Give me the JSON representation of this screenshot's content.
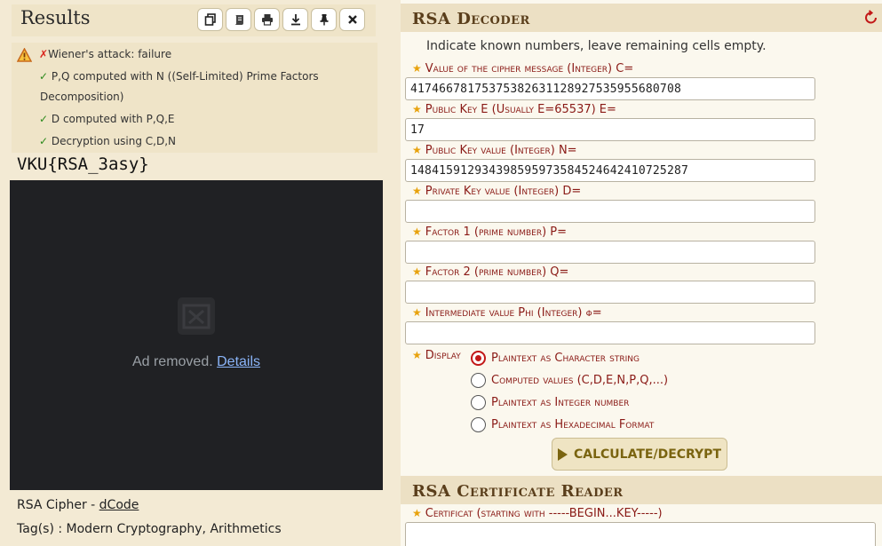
{
  "results": {
    "title": "Results",
    "toolbar": {
      "copy_icon": "copy-icon",
      "script_icon": "scroll-icon",
      "print_icon": "print-icon",
      "download_icon": "download-icon",
      "pin_icon": "pin-icon",
      "close_icon": "close-icon"
    },
    "log": {
      "attack_failed": "Wiener's attack: failure",
      "line_pq": "P,Q computed with N ((Self-Limited) Prime Factors",
      "line_pq_cont": "Decomposition)",
      "line_d": "D computed with P,Q,E",
      "line_decrypt": "Decryption using C,D,N"
    },
    "flag": "VKU{RSA_3asy}",
    "ad": {
      "text": "Ad removed.",
      "link": "Details"
    },
    "footer": {
      "cipher_name": "RSA Cipher - ",
      "cipher_link": "dCode",
      "tags": "Tag(s) : Modern Cryptography, Arithmetics"
    }
  },
  "decoder": {
    "title": "RSA Decoder",
    "instructions": "Indicate known numbers, leave remaining cells empty.",
    "fields": [
      {
        "label": "Value of the cipher message (Integer) C=",
        "value": "41746678175375382631128927535955680708"
      },
      {
        "label": "Public Key E (Usually E=65537) E=",
        "value": "17"
      },
      {
        "label": "Public Key value (Integer) N=",
        "value": "148415912934398595973584524642410725287"
      },
      {
        "label": "Private Key value (Integer) D=",
        "value": ""
      },
      {
        "label": "Factor 1 (prime number) P=",
        "value": ""
      },
      {
        "label": "Factor 2 (prime number) Q=",
        "value": ""
      },
      {
        "label": "Intermediate value Phi (Integer) φ=",
        "value": ""
      }
    ],
    "display_label": "Display",
    "display_options": [
      {
        "label": "Plaintext as Character string",
        "checked": true
      },
      {
        "label": "Computed values (C,D,E,N,P,Q,...)",
        "checked": false
      },
      {
        "label": "Plaintext as Integer number",
        "checked": false
      },
      {
        "label": "Plaintext as Hexadecimal Format",
        "checked": false
      }
    ],
    "calculate_label": "CALCULATE/DECRYPT"
  },
  "cert_reader": {
    "title": "RSA Certificate Reader",
    "field_label": "Certificat (starting with -----BEGIN...KEY-----)"
  },
  "colors": {
    "accent_dark_red": "#8a1a16",
    "section_title": "#5a3e1b",
    "ok_green": "#2d8a1d",
    "fail_red": "#d9241c"
  }
}
